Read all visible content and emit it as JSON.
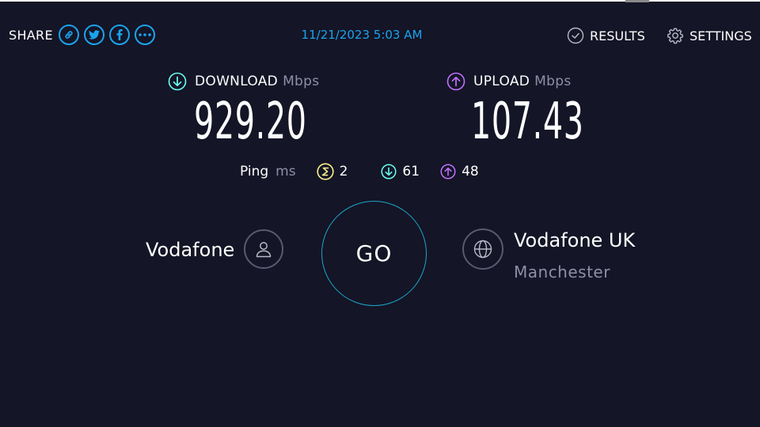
{
  "header": {
    "share_label": "SHARE",
    "share_buttons": [
      "link-icon",
      "twitter-icon",
      "facebook-icon",
      "more-icon"
    ],
    "datetime": "11/21/2023 5:03 AM",
    "results_label": "RESULTS",
    "settings_label": "SETTINGS"
  },
  "download": {
    "label": "DOWNLOAD",
    "unit": "Mbps",
    "value": "929.20",
    "icon": "download-arrow-icon",
    "color": "#6afff3"
  },
  "upload": {
    "label": "UPLOAD",
    "unit": "Mbps",
    "value": "107.43",
    "icon": "upload-arrow-icon",
    "color": "#bf71ff"
  },
  "ping": {
    "label": "Ping",
    "unit": "ms",
    "idle": "2",
    "download": "61",
    "upload": "48",
    "idle_color": "#fbf38a"
  },
  "provider": {
    "name": "Vodafone",
    "icon": "user-icon"
  },
  "go_label": "GO",
  "server": {
    "name": "Vodafone UK",
    "location": "Manchester",
    "icon": "globe-icon"
  },
  "colors": {
    "background": "#141526",
    "accent": "#1ba3ee",
    "muted": "#8e8fa6"
  }
}
